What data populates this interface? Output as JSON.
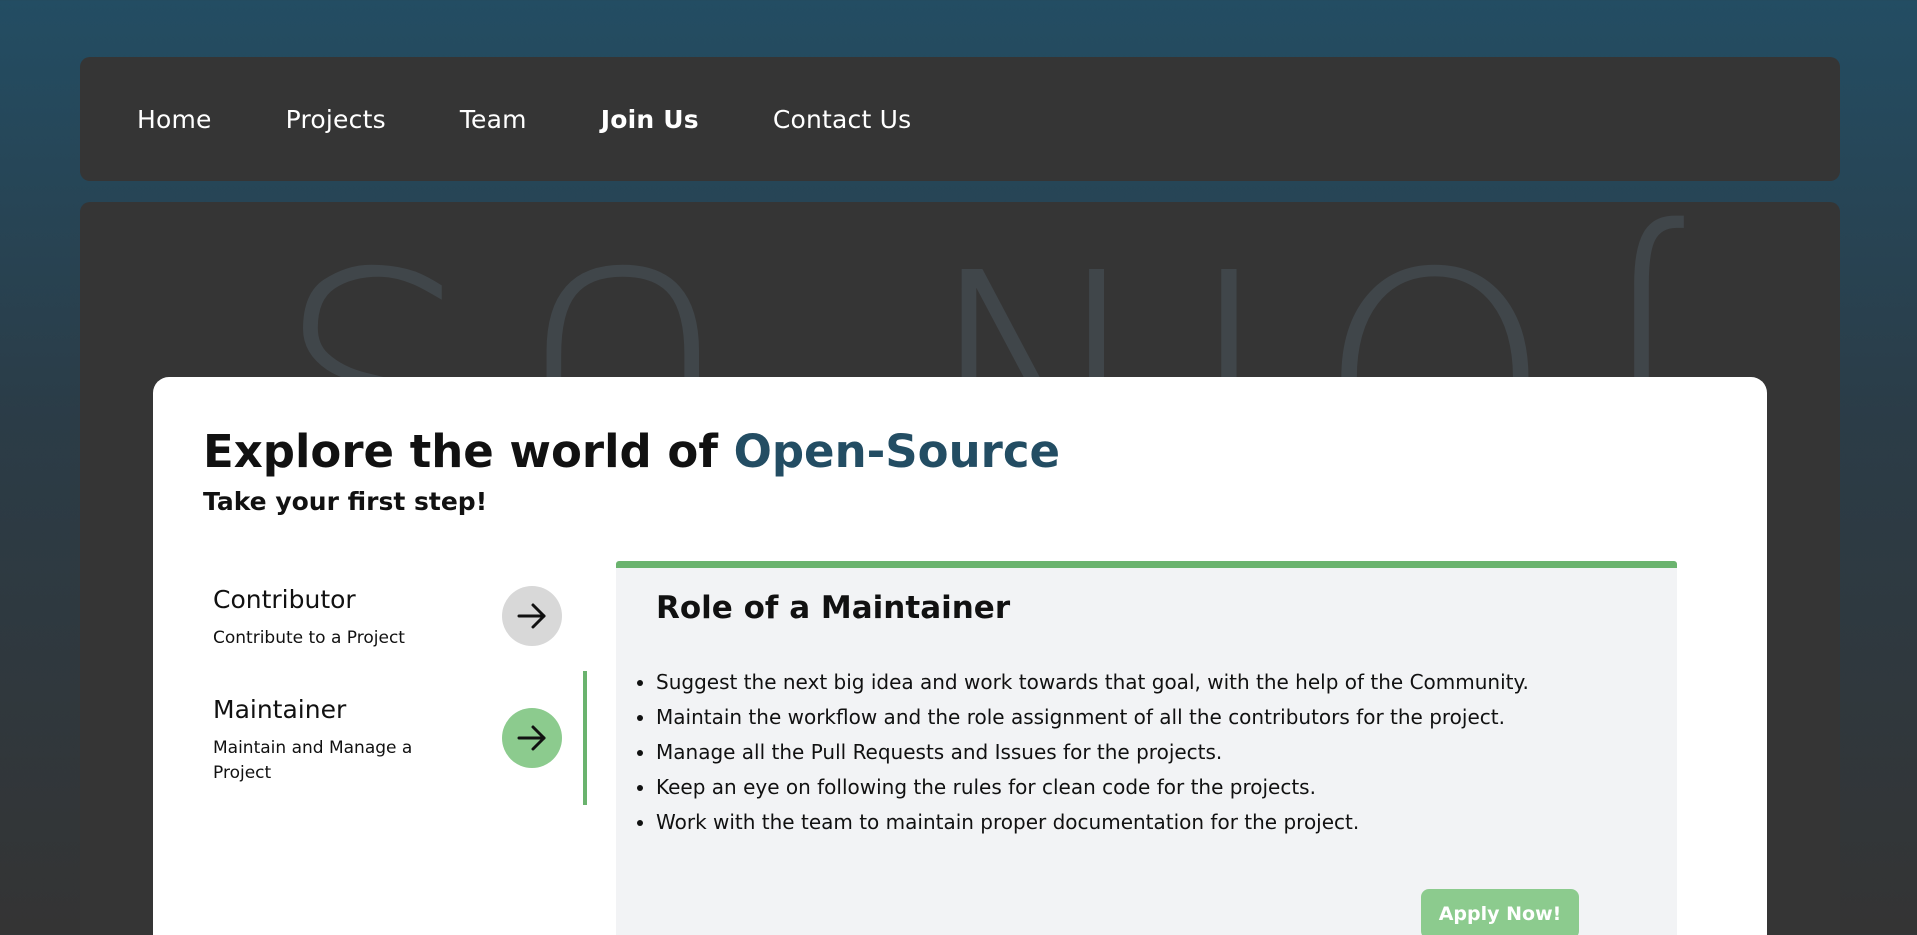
{
  "nav": {
    "items": [
      {
        "label": "Home",
        "active": false
      },
      {
        "label": "Projects",
        "active": false
      },
      {
        "label": "Team",
        "active": false
      },
      {
        "label": "Join Us",
        "active": true
      },
      {
        "label": "Contact Us",
        "active": false
      }
    ]
  },
  "hero": {
    "background_text": "JOIN US"
  },
  "card": {
    "title_prefix": "Explore the world of ",
    "title_accent": "Open-Source",
    "subtitle": "Take your first step!"
  },
  "roles": [
    {
      "name": "Contributor",
      "description": "Contribute to a Project",
      "active": false
    },
    {
      "name": "Maintainer",
      "description": "Maintain and Manage a Project",
      "active": true
    }
  ],
  "detail": {
    "title_prefix": "Role of a ",
    "title_role": "Maintainer",
    "duties": [
      "Suggest the next big idea and work towards that goal, with the help of the Community.",
      "Maintain the workflow and the role assignment of all the contributors for the project.",
      "Manage all the Pull Requests and Issues for the projects.",
      "Keep an eye on following the rules for clean code for the projects.",
      "Work with the team to maintain proper documentation for the project."
    ],
    "apply_label": "Apply Now!"
  },
  "icons": {
    "role_button": "arrow-right-icon"
  },
  "colors": {
    "accent_blue": "#234d63",
    "accent_green": "#6ab36e",
    "button_green": "#8ccb8e",
    "panel_bg": "#f2f3f5",
    "dark_surface": "#353535"
  }
}
